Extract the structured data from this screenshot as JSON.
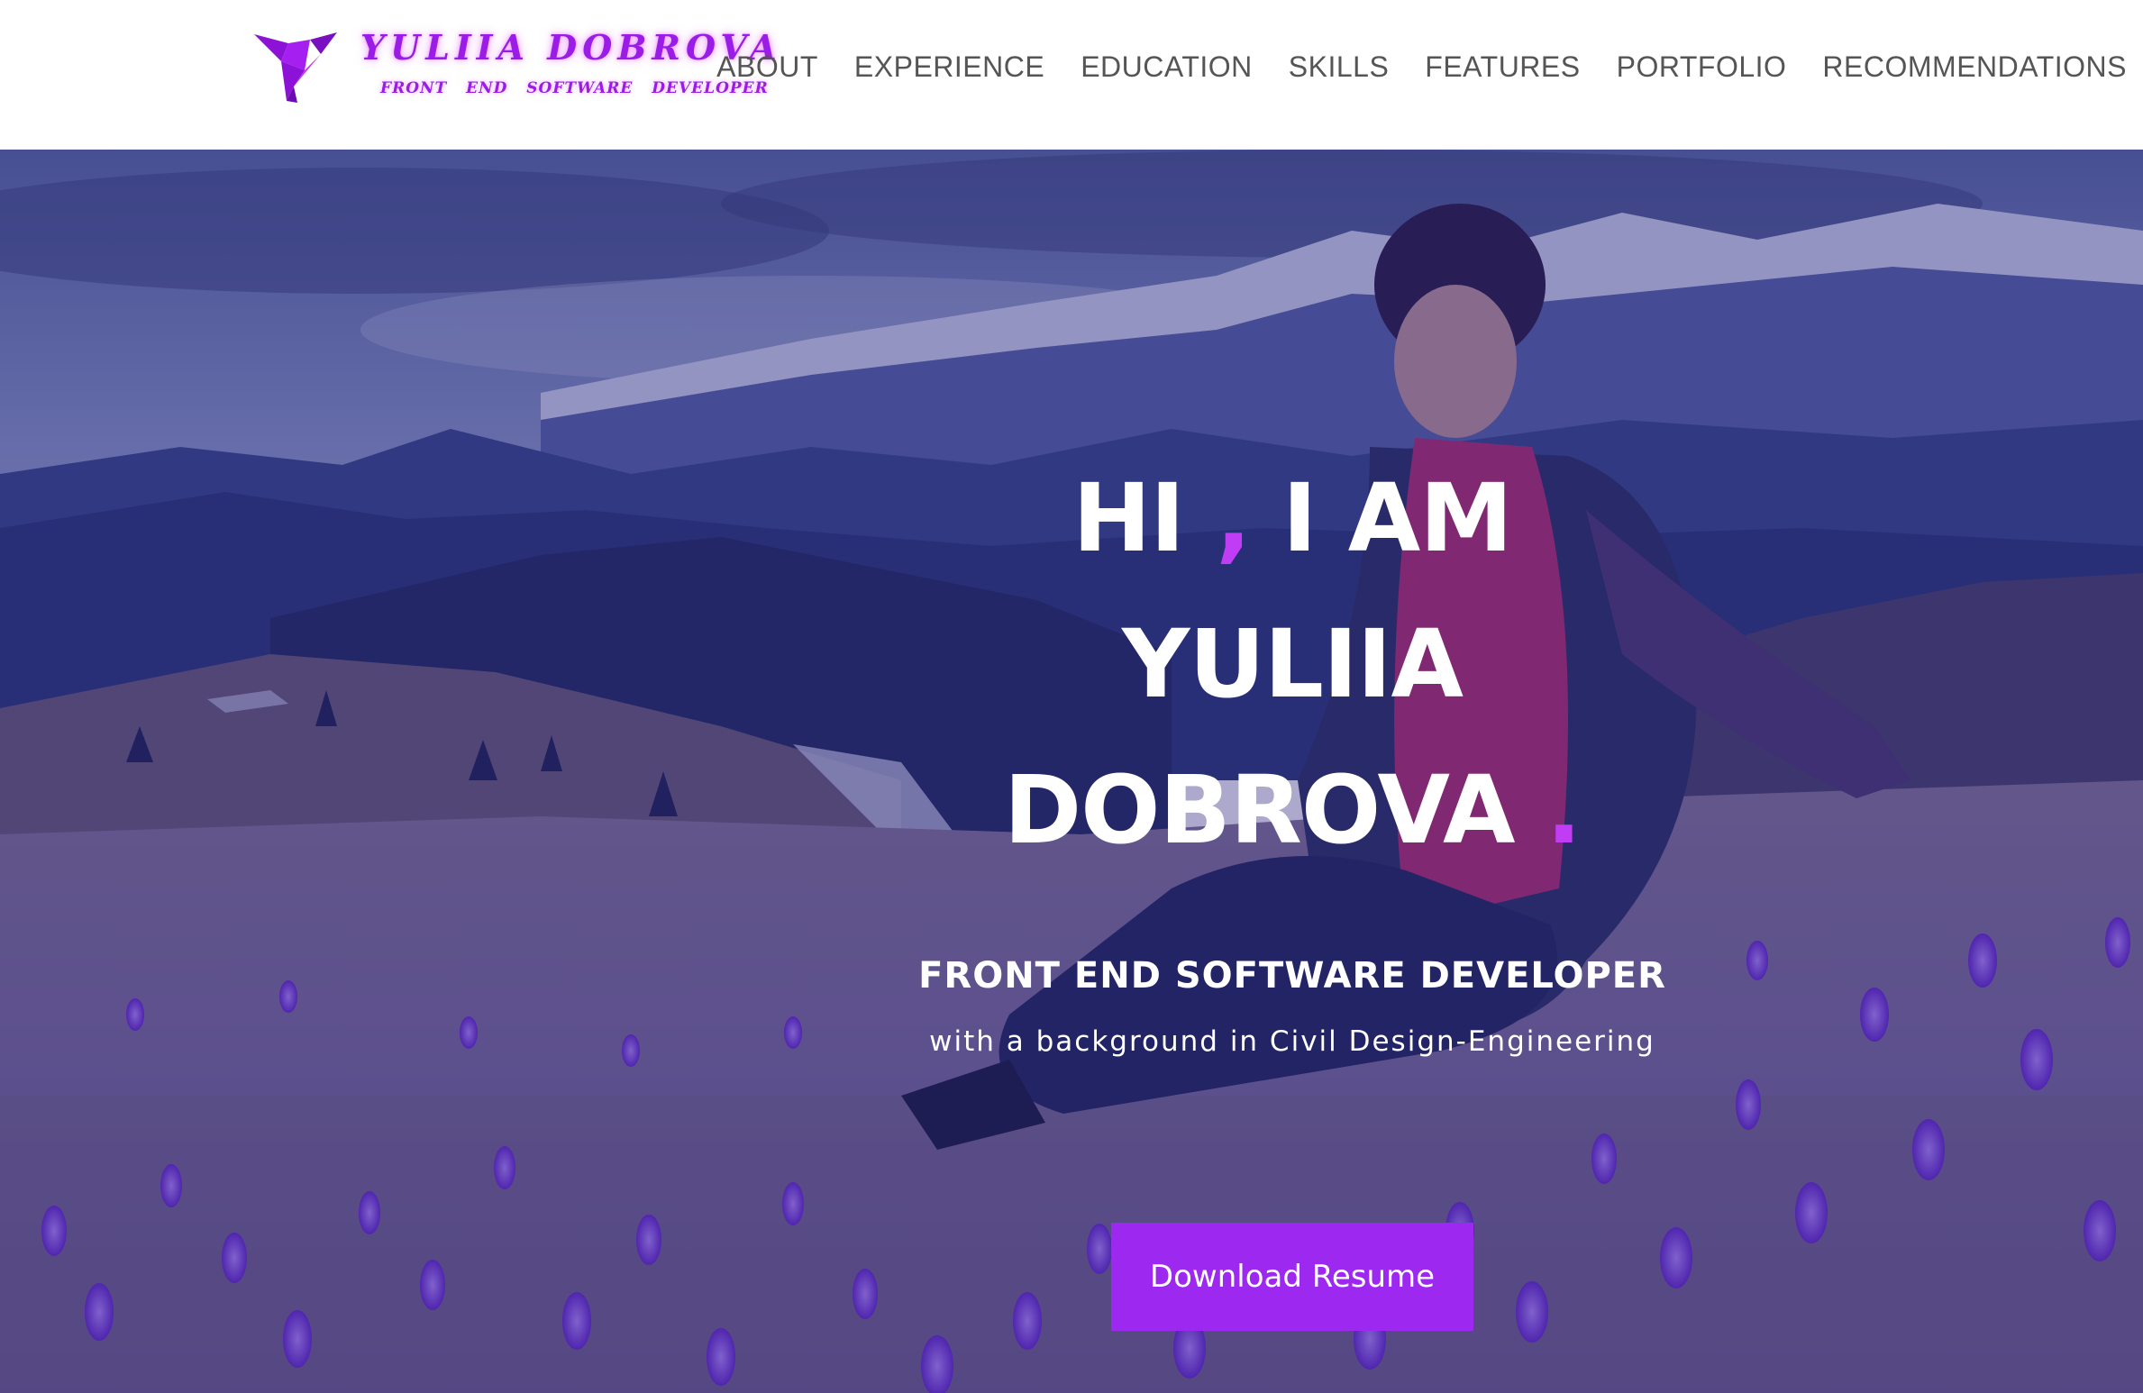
{
  "header": {
    "logo": {
      "name": "YULIIA DOBROVA",
      "tagline": "FRONT END SOFTWARE DEVELOPER",
      "icon": "origami-bird-icon"
    },
    "nav": [
      {
        "label": "ABOUT"
      },
      {
        "label": "EXPERIENCE"
      },
      {
        "label": "EDUCATION"
      },
      {
        "label": "SKILLS"
      },
      {
        "label": "FEATURES"
      },
      {
        "label": "PORTFOLIO"
      },
      {
        "label": "RECOMMENDATIONS"
      }
    ]
  },
  "hero": {
    "greeting": "HI",
    "comma": ",",
    "i_am": "I AM",
    "first_name": "YULIIA",
    "last_name": "DOBROVA",
    "period": ".",
    "role": "FRONT END SOFTWARE DEVELOPER",
    "background": "with a background in Civil Design-Engineering",
    "cta_label": "Download Resume"
  },
  "colors": {
    "accent": "#c03df5",
    "button": "#9d28f0",
    "nav_text": "#555555",
    "overlay": "#261c78"
  }
}
